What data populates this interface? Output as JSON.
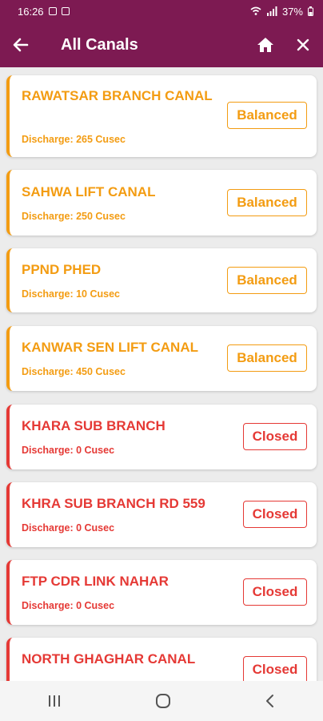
{
  "status_bar": {
    "time": "16:26",
    "battery": "37%"
  },
  "app_bar": {
    "title": "All Canals"
  },
  "canals": [
    {
      "name": "RAWATSAR BRANCH CANAL",
      "discharge": "Discharge: 265 Cusec",
      "status": "Balanced",
      "type": "balanced"
    },
    {
      "name": "SAHWA LIFT CANAL",
      "discharge": "Discharge: 250 Cusec",
      "status": "Balanced",
      "type": "balanced"
    },
    {
      "name": "PPND PHED",
      "discharge": "Discharge: 10 Cusec",
      "status": "Balanced",
      "type": "balanced"
    },
    {
      "name": "KANWAR SEN LIFT CANAL",
      "discharge": "Discharge: 450 Cusec",
      "status": "Balanced",
      "type": "balanced"
    },
    {
      "name": "KHARA SUB BRANCH",
      "discharge": "Discharge: 0 Cusec",
      "status": "Closed",
      "type": "closed"
    },
    {
      "name": "KHRA SUB BRANCH RD  559",
      "discharge": "Discharge: 0 Cusec",
      "status": "Closed",
      "type": "closed"
    },
    {
      "name": "FTP CDR LINK NAHAR",
      "discharge": "Discharge: 0 Cusec",
      "status": "Closed",
      "type": "closed"
    },
    {
      "name": "NORTH GHAGHAR CANAL",
      "discharge": "",
      "status": "Closed",
      "type": "closed"
    }
  ],
  "colors": {
    "primary": "#7d1a52",
    "balanced": "#f39c12",
    "closed": "#e53935"
  }
}
